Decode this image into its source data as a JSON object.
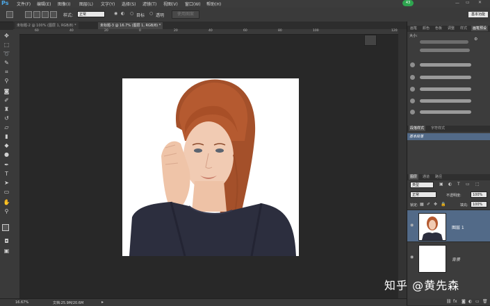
{
  "app": {
    "logo": "Ps",
    "menu": [
      "文件(F)",
      "编辑(E)",
      "图像(I)",
      "图层(L)",
      "文字(Y)",
      "选择(S)",
      "滤镜(T)",
      "视图(V)",
      "窗口(W)",
      "帮助(H)"
    ],
    "badge": "43"
  },
  "options": {
    "feather_label": "样式:",
    "style_value": "正常",
    "opt1": "目标",
    "opt2": "透明",
    "apply_button": "使用图案",
    "workspace_button": "基本功能"
  },
  "doc_tabs": [
    {
      "label": "未标题-2 @ 100% (图层 1, RGB/8) *",
      "active": false
    },
    {
      "label": "未标题-3 @ 16.7% (图层 1, RGB/8) *",
      "active": true
    }
  ],
  "ruler": {
    "h_ticks": [
      "60",
      "40",
      "20",
      "0",
      "20",
      "40",
      "60",
      "80",
      "100",
      "120"
    ]
  },
  "status": {
    "zoom": "16.67%",
    "doc": "文档:25.9M/20.6M"
  },
  "brush_panel": {
    "tabs": [
      "画笔",
      "颜色",
      "色板",
      "调整",
      "样式",
      "画笔预设"
    ],
    "size_label": "大小:"
  },
  "paragraph_panel": {
    "tabs": [
      "段落样式",
      "字符样式"
    ],
    "item": "基本段落"
  },
  "layers_panel": {
    "tabs": [
      "图层",
      "通道",
      "路径"
    ],
    "filter_kind": "类型",
    "blend_mode": "正常",
    "opacity_label": "不透明度:",
    "opacity_value": "100%",
    "lock_label": "锁定:",
    "fill_label": "填充:",
    "fill_value": "100%",
    "layers": [
      {
        "name": "图层 1",
        "selected": true
      },
      {
        "name": "背景",
        "selected": false
      }
    ]
  },
  "watermark": "知乎 @黄先森",
  "colors": {
    "ui_dark": "#282828",
    "panel": "#3c3c3c",
    "selected_layer": "#526a88",
    "logo_blue": "#4da9e8",
    "badge_green": "#2ea44f"
  }
}
